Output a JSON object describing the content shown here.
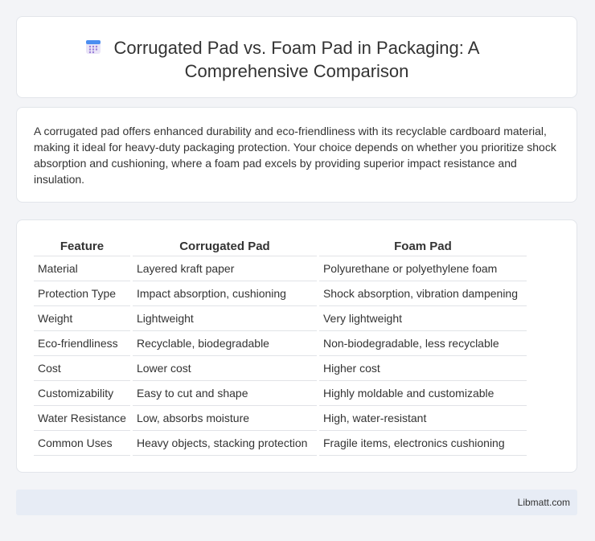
{
  "header": {
    "title_line1": "Corrugated Pad vs. Foam Pad in Packaging: A",
    "title_line2": "Comprehensive Comparison",
    "icon": "calendar-icon"
  },
  "summary": "A corrugated pad offers enhanced durability and eco-friendliness with its recyclable cardboard material, making it ideal for heavy-duty packaging protection. Your choice depends on whether you prioritize shock absorption and cushioning, where a foam pad excels by providing superior impact resistance and insulation.",
  "table": {
    "headers": [
      "Feature",
      "Corrugated Pad",
      "Foam Pad"
    ],
    "rows": [
      [
        "Material",
        "Layered kraft paper",
        "Polyurethane or polyethylene foam"
      ],
      [
        "Protection Type",
        "Impact absorption, cushioning",
        "Shock absorption, vibration dampening"
      ],
      [
        "Weight",
        "Lightweight",
        "Very lightweight"
      ],
      [
        "Eco-friendliness",
        "Recyclable, biodegradable",
        "Non-biodegradable, less recyclable"
      ],
      [
        "Cost",
        "Lower cost",
        "Higher cost"
      ],
      [
        "Customizability",
        "Easy to cut and shape",
        "Highly moldable and customizable"
      ],
      [
        "Water Resistance",
        "Low, absorbs moisture",
        "High, water-resistant"
      ],
      [
        "Common Uses",
        "Heavy objects, stacking protection",
        "Fragile items, electronics cushioning"
      ]
    ]
  },
  "footer": {
    "site": "Libmatt.com"
  }
}
